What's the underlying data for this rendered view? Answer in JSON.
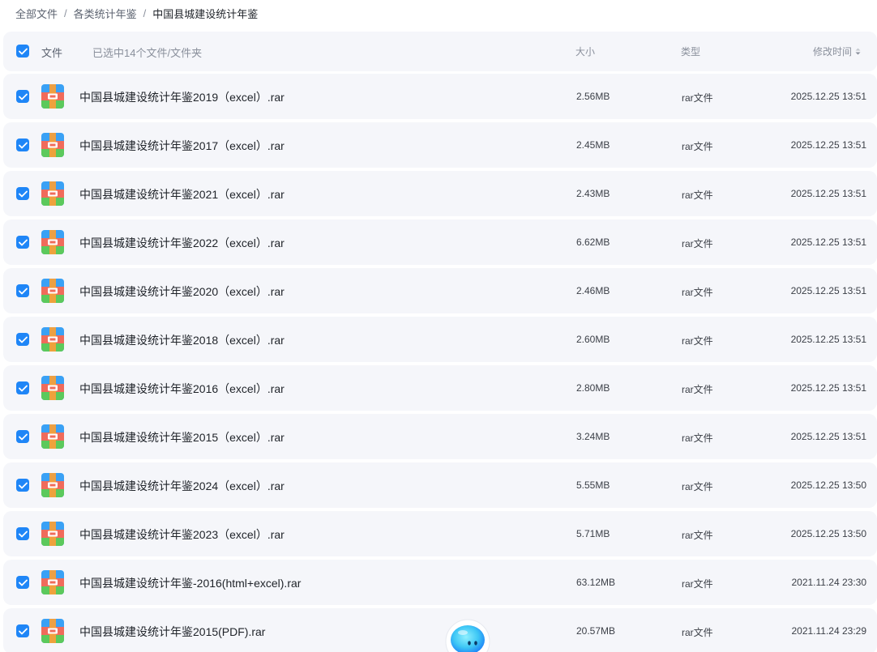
{
  "breadcrumb": {
    "items": [
      "全部文件",
      "各类统计年鉴",
      "中国县城建设统计年鉴"
    ],
    "separator": "/"
  },
  "header": {
    "file_label": "文件",
    "selected_text": "已选中14个文件/文件夹",
    "size_label": "大小",
    "type_label": "类型",
    "modified_label": "修改时间"
  },
  "colors": {
    "accent": "#1f86f7",
    "row_bg": "#f5f6fa",
    "rar_blue": "#3aa1f5",
    "rar_orange": "#f6a03a",
    "rar_red": "#f06b5b",
    "rar_green": "#5cc95c"
  },
  "icons": {
    "checkbox": "checkbox-checked-icon",
    "file": "rar-archive-icon",
    "sort": "sort-caret-icon",
    "assistant": "ai-assistant-icon"
  },
  "files": [
    {
      "name": "中国县城建设统计年鉴2019（excel）.rar",
      "size": "2.56MB",
      "type": "rar文件",
      "modified": "2025.12.25 13:51"
    },
    {
      "name": "中国县城建设统计年鉴2017（excel）.rar",
      "size": "2.45MB",
      "type": "rar文件",
      "modified": "2025.12.25 13:51"
    },
    {
      "name": "中国县城建设统计年鉴2021（excel）.rar",
      "size": "2.43MB",
      "type": "rar文件",
      "modified": "2025.12.25 13:51"
    },
    {
      "name": "中国县城建设统计年鉴2022（excel）.rar",
      "size": "6.62MB",
      "type": "rar文件",
      "modified": "2025.12.25 13:51"
    },
    {
      "name": "中国县城建设统计年鉴2020（excel）.rar",
      "size": "2.46MB",
      "type": "rar文件",
      "modified": "2025.12.25 13:51"
    },
    {
      "name": "中国县城建设统计年鉴2018（excel）.rar",
      "size": "2.60MB",
      "type": "rar文件",
      "modified": "2025.12.25 13:51"
    },
    {
      "name": "中国县城建设统计年鉴2016（excel）.rar",
      "size": "2.80MB",
      "type": "rar文件",
      "modified": "2025.12.25 13:51"
    },
    {
      "name": "中国县城建设统计年鉴2015（excel）.rar",
      "size": "3.24MB",
      "type": "rar文件",
      "modified": "2025.12.25 13:51"
    },
    {
      "name": "中国县城建设统计年鉴2024（excel）.rar",
      "size": "5.55MB",
      "type": "rar文件",
      "modified": "2025.12.25 13:50"
    },
    {
      "name": "中国县城建设统计年鉴2023（excel）.rar",
      "size": "5.71MB",
      "type": "rar文件",
      "modified": "2025.12.25 13:50"
    },
    {
      "name": "中国县城建设统计年鉴-2016(html+excel).rar",
      "size": "63.12MB",
      "type": "rar文件",
      "modified": "2021.11.24 23:30"
    },
    {
      "name": "中国县城建设统计年鉴2015(PDF).rar",
      "size": "20.57MB",
      "type": "rar文件",
      "modified": "2021.11.24 23:29"
    }
  ]
}
